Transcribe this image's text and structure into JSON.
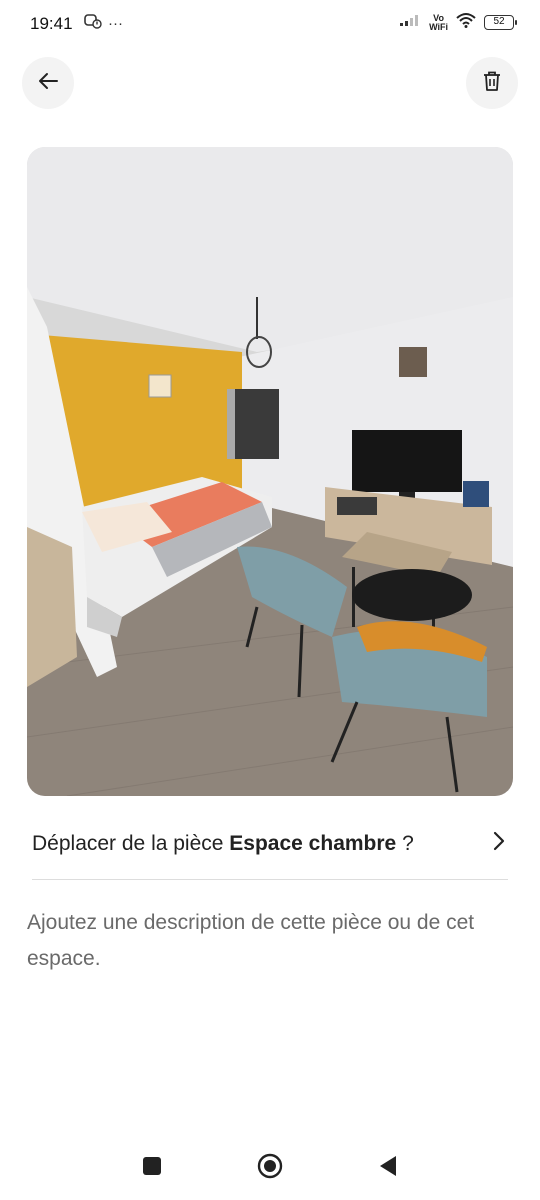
{
  "status_bar": {
    "time": "19:41",
    "more": "···",
    "vowifi_top": "Vo",
    "vowifi_bottom": "WiFi",
    "battery": "52"
  },
  "header": {
    "back_icon": "arrow-left-icon",
    "delete_icon": "trash-icon"
  },
  "photo": {
    "subject": "room-photo"
  },
  "move_room": {
    "prefix": "Déplacer de la pièce ",
    "room_name": "Espace chambre",
    "suffix": " ?",
    "chevron_icon": "chevron-right-icon"
  },
  "description": {
    "placeholder": "Ajoutez une description de cette pièce ou de cet espace."
  },
  "nav_bar": {
    "recent_icon": "square-icon",
    "home_icon": "home-circle-icon",
    "back_icon": "triangle-back-icon"
  },
  "colors": {
    "accent_wall": "#e0a92c",
    "chair": "#7f9ea7",
    "pillow": "#d88d2b",
    "floor": "#8f857b",
    "text_primary": "#222222",
    "text_secondary": "#6a6a6a"
  }
}
